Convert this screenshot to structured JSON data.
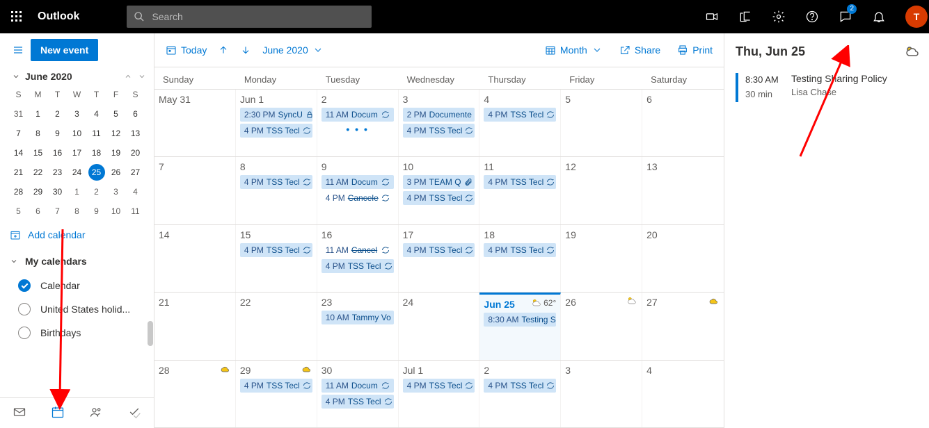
{
  "header": {
    "product": "Outlook",
    "search_placeholder": "Search",
    "avatar_initial": "T",
    "chat_badge": "2"
  },
  "left": {
    "new_event": "New event",
    "mini_month": "June 2020",
    "day_headers": [
      "S",
      "M",
      "T",
      "W",
      "T",
      "F",
      "S"
    ],
    "mini_days": [
      {
        "n": "31",
        "in": false
      },
      {
        "n": "1",
        "in": true
      },
      {
        "n": "2",
        "in": true
      },
      {
        "n": "3",
        "in": true
      },
      {
        "n": "4",
        "in": true
      },
      {
        "n": "5",
        "in": true
      },
      {
        "n": "6",
        "in": true
      },
      {
        "n": "7",
        "in": true
      },
      {
        "n": "8",
        "in": true
      },
      {
        "n": "9",
        "in": true
      },
      {
        "n": "10",
        "in": true
      },
      {
        "n": "11",
        "in": true
      },
      {
        "n": "12",
        "in": true
      },
      {
        "n": "13",
        "in": true
      },
      {
        "n": "14",
        "in": true
      },
      {
        "n": "15",
        "in": true
      },
      {
        "n": "16",
        "in": true
      },
      {
        "n": "17",
        "in": true
      },
      {
        "n": "18",
        "in": true
      },
      {
        "n": "19",
        "in": true
      },
      {
        "n": "20",
        "in": true
      },
      {
        "n": "21",
        "in": true
      },
      {
        "n": "22",
        "in": true
      },
      {
        "n": "23",
        "in": true
      },
      {
        "n": "24",
        "in": true
      },
      {
        "n": "25",
        "in": true,
        "today": true
      },
      {
        "n": "26",
        "in": true
      },
      {
        "n": "27",
        "in": true
      },
      {
        "n": "28",
        "in": true
      },
      {
        "n": "29",
        "in": true
      },
      {
        "n": "30",
        "in": true
      },
      {
        "n": "1",
        "in": false
      },
      {
        "n": "2",
        "in": false
      },
      {
        "n": "3",
        "in": false
      },
      {
        "n": "4",
        "in": false
      },
      {
        "n": "5",
        "in": false
      },
      {
        "n": "6",
        "in": false
      },
      {
        "n": "7",
        "in": false
      },
      {
        "n": "8",
        "in": false
      },
      {
        "n": "9",
        "in": false
      },
      {
        "n": "10",
        "in": false
      },
      {
        "n": "11",
        "in": false
      }
    ],
    "add_calendar": "Add calendar",
    "my_calendars": "My calendars",
    "calendars": [
      {
        "name": "Calendar",
        "checked": true
      },
      {
        "name": "United States holid...",
        "checked": false
      },
      {
        "name": "Birthdays",
        "checked": false
      }
    ]
  },
  "toolbar": {
    "today": "Today",
    "month_label": "June 2020",
    "view": "Month",
    "share": "Share",
    "print": "Print"
  },
  "grid": {
    "day_headers": [
      "Sunday",
      "Monday",
      "Tuesday",
      "Wednesday",
      "Thursday",
      "Friday",
      "Saturday"
    ],
    "weeks": [
      [
        {
          "label": "May 31",
          "events": []
        },
        {
          "label": "Jun 1",
          "events": [
            {
              "time": "2:30 PM",
              "title": "SyncU",
              "icon": "lock"
            },
            {
              "time": "4 PM",
              "title": "TSS Tecl",
              "icon": "recur"
            }
          ]
        },
        {
          "label": "2",
          "events": [
            {
              "time": "11 AM",
              "title": "Docum",
              "icon": "recur"
            }
          ],
          "more": true
        },
        {
          "label": "3",
          "events": [
            {
              "time": "2 PM",
              "title": "Documente",
              "icon": "none"
            },
            {
              "time": "4 PM",
              "title": "TSS Tecl",
              "icon": "recur"
            }
          ]
        },
        {
          "label": "4",
          "events": [
            {
              "time": "4 PM",
              "title": "TSS Tecl",
              "icon": "recur"
            }
          ]
        },
        {
          "label": "5",
          "events": []
        },
        {
          "label": "6",
          "events": []
        }
      ],
      [
        {
          "label": "7",
          "events": []
        },
        {
          "label": "8",
          "events": [
            {
              "time": "4 PM",
              "title": "TSS Tecl",
              "icon": "recur"
            }
          ]
        },
        {
          "label": "9",
          "events": [
            {
              "time": "11 AM",
              "title": "Docum",
              "icon": "recur"
            },
            {
              "time": "4 PM",
              "title": "Cancele",
              "icon": "recur",
              "plain": true,
              "strike": true
            }
          ]
        },
        {
          "label": "10",
          "events": [
            {
              "time": "3 PM",
              "title": "TEAM Q",
              "icon": "attach"
            },
            {
              "time": "4 PM",
              "title": "TSS Tecl",
              "icon": "recur"
            }
          ]
        },
        {
          "label": "11",
          "events": [
            {
              "time": "4 PM",
              "title": "TSS Tecl",
              "icon": "recur"
            }
          ]
        },
        {
          "label": "12",
          "events": []
        },
        {
          "label": "13",
          "events": []
        }
      ],
      [
        {
          "label": "14",
          "events": []
        },
        {
          "label": "15",
          "events": [
            {
              "time": "4 PM",
              "title": "TSS Tecl",
              "icon": "recur"
            }
          ]
        },
        {
          "label": "16",
          "events": [
            {
              "time": "11 AM",
              "title": "Cancel",
              "icon": "recur",
              "plain": true,
              "strike": true
            },
            {
              "time": "4 PM",
              "title": "TSS Tecl",
              "icon": "recur"
            }
          ]
        },
        {
          "label": "17",
          "events": [
            {
              "time": "4 PM",
              "title": "TSS Tecl",
              "icon": "recur"
            }
          ]
        },
        {
          "label": "18",
          "events": [
            {
              "time": "4 PM",
              "title": "TSS Tecl",
              "icon": "recur"
            }
          ]
        },
        {
          "label": "19",
          "events": []
        },
        {
          "label": "20",
          "events": []
        }
      ],
      [
        {
          "label": "21",
          "events": []
        },
        {
          "label": "22",
          "events": []
        },
        {
          "label": "23",
          "events": [
            {
              "time": "10 AM",
              "title": "Tammy Vo",
              "icon": "none"
            }
          ]
        },
        {
          "label": "24",
          "events": []
        },
        {
          "label": "Jun 25",
          "today": true,
          "wx": "62°",
          "events": [
            {
              "time": "8:30 AM",
              "title": "Testing S",
              "icon": "none"
            }
          ]
        },
        {
          "label": "26",
          "wxicon": true,
          "events": []
        },
        {
          "label": "27",
          "wxcloud": true,
          "events": []
        }
      ],
      [
        {
          "label": "28",
          "wxcloud": true,
          "events": []
        },
        {
          "label": "29",
          "wxcloudonly": true,
          "events": [
            {
              "time": "4 PM",
              "title": "TSS Tecl",
              "icon": "recur"
            }
          ]
        },
        {
          "label": "30",
          "events": [
            {
              "time": "11 AM",
              "title": "Docum",
              "icon": "recur"
            },
            {
              "time": "4 PM",
              "title": "TSS Tecl",
              "icon": "recur"
            }
          ]
        },
        {
          "label": "Jul 1",
          "events": [
            {
              "time": "4 PM",
              "title": "TSS Tecl",
              "icon": "recur"
            }
          ]
        },
        {
          "label": "2",
          "events": [
            {
              "time": "4 PM",
              "title": "TSS Tecl",
              "icon": "recur"
            }
          ]
        },
        {
          "label": "3",
          "events": []
        },
        {
          "label": "4",
          "events": []
        }
      ]
    ]
  },
  "details": {
    "date": "Thu, Jun 25",
    "apt_time": "8:30 AM",
    "apt_dur": "30 min",
    "apt_title": "Testing Sharing Policy",
    "apt_who": "Lisa Chase"
  }
}
